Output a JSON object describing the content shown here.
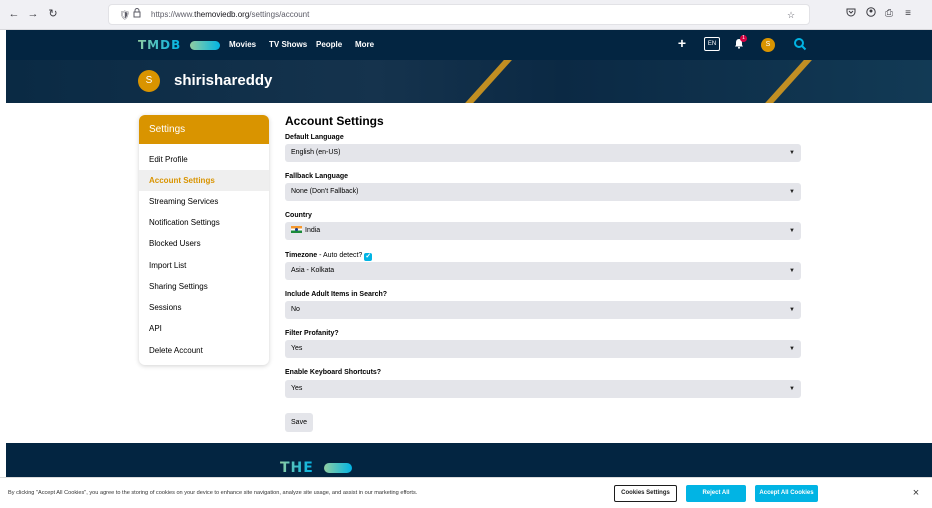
{
  "browser": {
    "url_prefix": "https://www.",
    "url_domain": "themoviedb.org",
    "url_path": "/settings/account",
    "icons": [
      "back-icon",
      "forward-icon",
      "reload-icon",
      "shield-icon",
      "lock-icon",
      "bookmark-star-icon",
      "pocket-icon",
      "account-icon",
      "extensions-icon",
      "menu-icon"
    ]
  },
  "header": {
    "logo": "TMDB",
    "nav": [
      "Movies",
      "TV Shows",
      "People",
      "More"
    ],
    "language": "EN",
    "notification_count": "1",
    "avatar_initial": "S"
  },
  "banner": {
    "avatar_initial": "S",
    "username": "shirishareddy"
  },
  "sidebar": {
    "title": "Settings",
    "items": [
      {
        "label": "Edit Profile"
      },
      {
        "label": "Account Settings"
      },
      {
        "label": "Streaming Services"
      },
      {
        "label": "Notification Settings"
      },
      {
        "label": "Blocked Users"
      },
      {
        "label": "Import List"
      },
      {
        "label": "Sharing Settings"
      },
      {
        "label": "Sessions"
      },
      {
        "label": "API"
      },
      {
        "label": "Delete Account"
      }
    ],
    "active_index": 1
  },
  "settings": {
    "title": "Account Settings",
    "default_language": {
      "label": "Default Language",
      "value": "English (en-US)"
    },
    "fallback_language": {
      "label": "Fallback Language",
      "value": "None (Don't Fallback)"
    },
    "country": {
      "label": "Country",
      "value": "India"
    },
    "timezone": {
      "label": "Timezone",
      "auto_detect_label": " - Auto detect?",
      "auto_detect_checked": true,
      "value": "Asia - Kolkata"
    },
    "adult": {
      "label": "Include Adult Items in Search?",
      "value": "No"
    },
    "profanity": {
      "label": "Filter Profanity?",
      "value": "Yes"
    },
    "keyboard": {
      "label": "Enable Keyboard Shortcuts?",
      "value": "Yes"
    },
    "save_label": "Save"
  },
  "footer": {
    "logo": "THE"
  },
  "cookies": {
    "text": "By clicking \"Accept All Cookies\", you agree to the storing of cookies on your device to enhance site navigation, analyze site usage, and assist in our marketing efforts.",
    "settings_label": "Cookies Settings",
    "reject_label": "Reject All",
    "accept_label": "Accept All Cookies",
    "close_label": "×"
  },
  "colors": {
    "brand_dark": "#032541",
    "accent_orange": "#d99400",
    "accent_blue": "#01b4e4",
    "select_bg": "#e4e5ea"
  }
}
